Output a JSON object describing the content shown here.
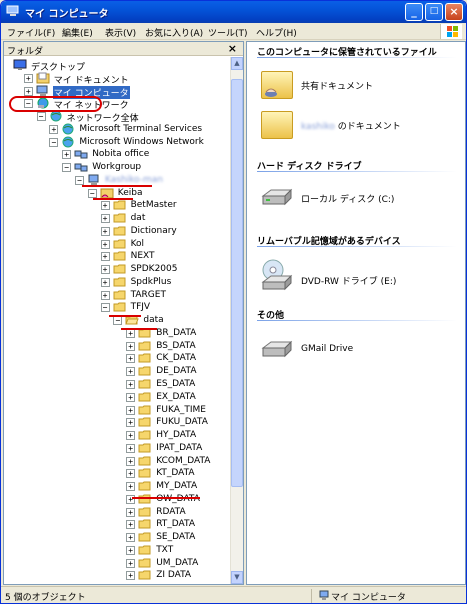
{
  "window": {
    "title": "マイ コンピュータ",
    "minimize": "_",
    "maximize": "□",
    "close": "×"
  },
  "menu": [
    "ファイル(F)",
    "編集(E)",
    "表示(V)",
    "お気に入り(A)",
    "ツール(T)",
    "ヘルプ(H)"
  ],
  "folders_pane": {
    "title": "フォルダ",
    "close": "×"
  },
  "tree": [
    {
      "label": "デスクトップ",
      "level": 0,
      "expander": "",
      "icon": "desktop-icon"
    },
    {
      "label": "マイ ドキュメント",
      "level": 1,
      "expander": "+",
      "icon": "my-documents-icon"
    },
    {
      "label": "マイ コンピュータ",
      "level": 1,
      "expander": "+",
      "icon": "my-computer-icon",
      "selected": true
    },
    {
      "label": "マイ ネットワーク",
      "level": 1,
      "expander": "−",
      "icon": "my-network-icon"
    },
    {
      "label": "ネットワーク全体",
      "level": 2,
      "expander": "−",
      "icon": "network-globe-icon"
    },
    {
      "label": "Microsoft Terminal Services",
      "level": 3,
      "expander": "+",
      "icon": "network-globe-icon"
    },
    {
      "label": "Microsoft Windows Network",
      "level": 3,
      "expander": "−",
      "icon": "network-globe-icon"
    },
    {
      "label": "Nobita office",
      "level": 4,
      "expander": "+",
      "icon": "workgroup-icon"
    },
    {
      "label": "Workgroup",
      "level": 4,
      "expander": "−",
      "icon": "workgroup-icon"
    },
    {
      "label": "Kashiko-man",
      "level": 5,
      "expander": "−",
      "icon": "computer-icon",
      "blurred": true
    },
    {
      "label": "Keiba",
      "level": 6,
      "expander": "−",
      "icon": "shared-folder-icon"
    },
    {
      "label": "BetMaster",
      "level": 7,
      "expander": "+",
      "icon": "folder-icon"
    },
    {
      "label": "dat",
      "level": 7,
      "expander": "+",
      "icon": "folder-icon"
    },
    {
      "label": "Dictionary",
      "level": 7,
      "expander": "+",
      "icon": "folder-icon"
    },
    {
      "label": "Kol",
      "level": 7,
      "expander": "+",
      "icon": "folder-icon"
    },
    {
      "label": "NEXT",
      "level": 7,
      "expander": "+",
      "icon": "folder-icon"
    },
    {
      "label": "SPDK2005",
      "level": 7,
      "expander": "+",
      "icon": "folder-icon"
    },
    {
      "label": "SpdkPlus",
      "level": 7,
      "expander": "+",
      "icon": "folder-icon"
    },
    {
      "label": "TARGET",
      "level": 7,
      "expander": "+",
      "icon": "folder-icon"
    },
    {
      "label": "TFJV",
      "level": 7,
      "expander": "−",
      "icon": "folder-icon"
    },
    {
      "label": "data",
      "level": 8,
      "expander": "−",
      "icon": "folder-open-icon"
    },
    {
      "label": "BR_DATA",
      "level": 9,
      "expander": "+",
      "icon": "folder-icon"
    },
    {
      "label": "BS_DATA",
      "level": 9,
      "expander": "+",
      "icon": "folder-icon"
    },
    {
      "label": "CK_DATA",
      "level": 9,
      "expander": "+",
      "icon": "folder-icon"
    },
    {
      "label": "DE_DATA",
      "level": 9,
      "expander": "+",
      "icon": "folder-icon"
    },
    {
      "label": "ES_DATA",
      "level": 9,
      "expander": "+",
      "icon": "folder-icon"
    },
    {
      "label": "EX_DATA",
      "level": 9,
      "expander": "+",
      "icon": "folder-icon"
    },
    {
      "label": "FUKA_TIME",
      "level": 9,
      "expander": "+",
      "icon": "folder-icon"
    },
    {
      "label": "FUKU_DATA",
      "level": 9,
      "expander": "+",
      "icon": "folder-icon"
    },
    {
      "label": "HY_DATA",
      "level": 9,
      "expander": "+",
      "icon": "folder-icon"
    },
    {
      "label": "IPAT_DATA",
      "level": 9,
      "expander": "+",
      "icon": "folder-icon"
    },
    {
      "label": "KCOM_DATA",
      "level": 9,
      "expander": "+",
      "icon": "folder-icon"
    },
    {
      "label": "KT_DATA",
      "level": 9,
      "expander": "+",
      "icon": "folder-icon"
    },
    {
      "label": "MY_DATA",
      "level": 9,
      "expander": "+",
      "icon": "folder-icon"
    },
    {
      "label": "OW_DATA",
      "level": 9,
      "expander": "+",
      "icon": "folder-icon"
    },
    {
      "label": "RDATA",
      "level": 9,
      "expander": "+",
      "icon": "folder-icon"
    },
    {
      "label": "RT_DATA",
      "level": 9,
      "expander": "+",
      "icon": "folder-icon"
    },
    {
      "label": "SE_DATA",
      "level": 9,
      "expander": "+",
      "icon": "folder-icon"
    },
    {
      "label": "TXT",
      "level": 9,
      "expander": "+",
      "icon": "folder-icon"
    },
    {
      "label": "UM_DATA",
      "level": 9,
      "expander": "+",
      "icon": "folder-icon"
    },
    {
      "label": "ZI DATA",
      "level": 9,
      "expander": "+",
      "icon": "folder-icon"
    }
  ],
  "content": {
    "groups": [
      {
        "header": "このコンピュータに保管されているファイル",
        "items": [
          {
            "label": "共有ドキュメント",
            "icon": "shared-documents-icon"
          },
          {
            "label": "のドキュメント",
            "prefix": "kashiko",
            "icon": "user-documents-icon"
          }
        ]
      },
      {
        "header": "ハード ディスク ドライブ",
        "items": [
          {
            "label": "ローカル ディスク (C:)",
            "icon": "hard-disk-icon"
          }
        ]
      },
      {
        "header": "リムーバブル記憶域があるデバイス",
        "items": [
          {
            "label": "DVD-RW ドライブ (E:)",
            "icon": "dvd-drive-icon"
          }
        ]
      },
      {
        "header": "その他",
        "items": [
          {
            "label": "GMail Drive",
            "icon": "gmail-drive-icon"
          }
        ]
      }
    ]
  },
  "status": {
    "left": "5 個のオブジェクト",
    "right": "マイ コンピュータ"
  },
  "colors": {
    "title_bar": "#0453d8",
    "selection": "#316ac5",
    "annotation_red": "#d90000",
    "pane_border": "#7f9db9"
  }
}
